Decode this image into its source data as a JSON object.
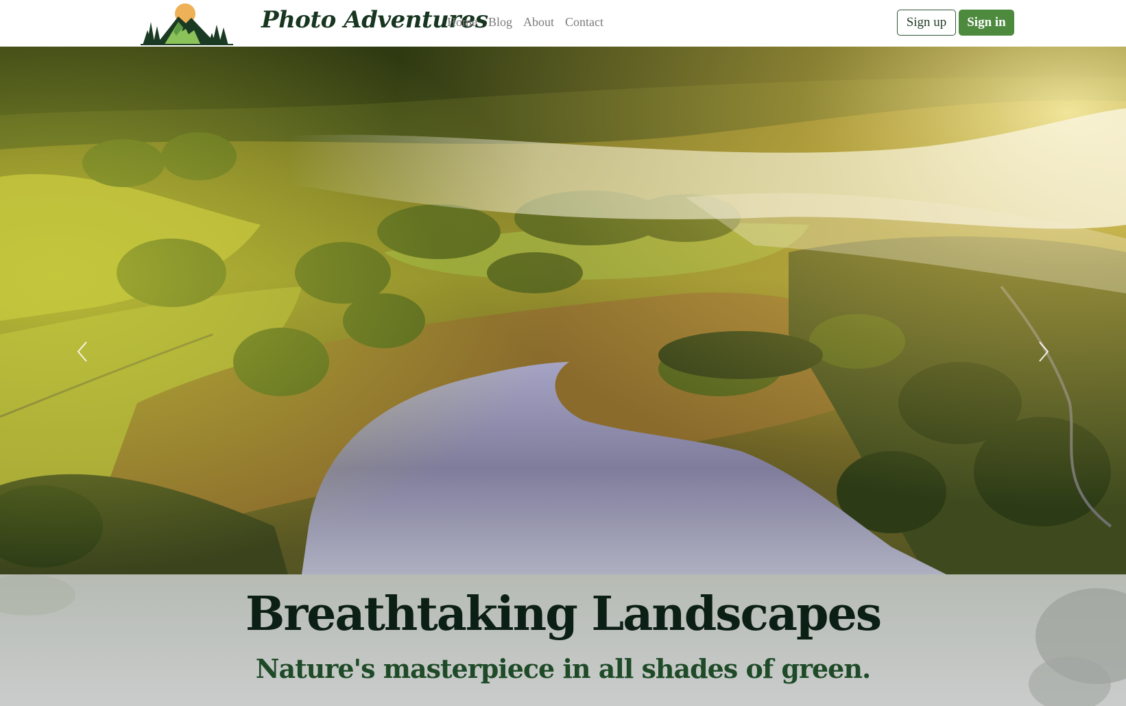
{
  "navbar": {
    "brand": "Photo Adventures",
    "links": [
      "Home",
      "Blog",
      "About",
      "Contact"
    ],
    "signup_label": "Sign up",
    "signin_label": "Sign in"
  },
  "hero": {
    "title": "Breathtaking Landscapes",
    "subtitle": "Nature's masterpiece in all shades of green.",
    "prev_icon": "chevron-left-icon",
    "next_icon": "chevron-right-icon"
  },
  "colors": {
    "brand_dark": "#17351f",
    "accent_green": "#4d8a3e",
    "nav_link": "#7a7a7a"
  }
}
